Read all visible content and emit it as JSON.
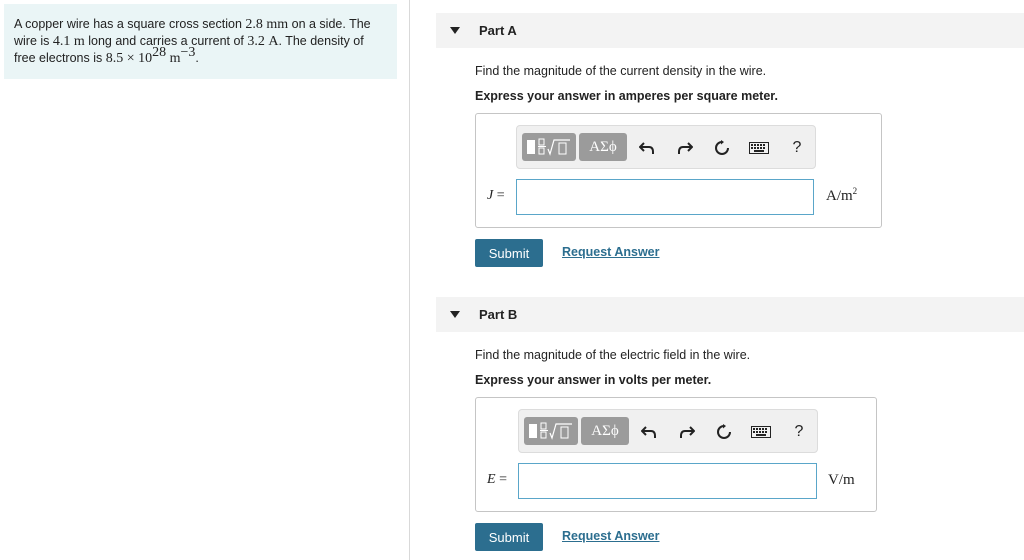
{
  "problem": {
    "line1_a": "A copper wire has a square cross section ",
    "side_value": "2.8",
    "side_unit": "mm",
    "line1_b": " on a side. The",
    "line2_a": "wire is ",
    "length_value": "4.1",
    "length_unit": "m",
    "line2_b": " long and carries a current of ",
    "current_value": "3.2",
    "current_unit": "A",
    "line2_c": ". The density of",
    "line3_a": "free electrons is ",
    "density_mantissa": "8.5 × 10",
    "density_exp": "28",
    "density_unit": "m",
    "density_unit_exp": "−3",
    "line3_end": "."
  },
  "toolbar": {
    "template_icon": "fraction-sqrt-template-icon",
    "greek_label": "ΑΣϕ",
    "help_label": "?"
  },
  "partA": {
    "title": "Part A",
    "question": "Find the magnitude of the current density in the wire.",
    "instruction": "Express your answer in amperes per square meter.",
    "var": "J",
    "equals": "=",
    "input_value": "",
    "unit_base": "A/m",
    "unit_exp": "2",
    "submit_label": "Submit",
    "request_label": "Request Answer"
  },
  "partB": {
    "title": "Part B",
    "question": "Find the magnitude of the electric field in the wire.",
    "instruction": "Express your answer in volts per meter.",
    "var": "E",
    "equals": "=",
    "input_value": "",
    "unit": "V/m",
    "submit_label": "Submit",
    "request_label": "Request Answer"
  }
}
